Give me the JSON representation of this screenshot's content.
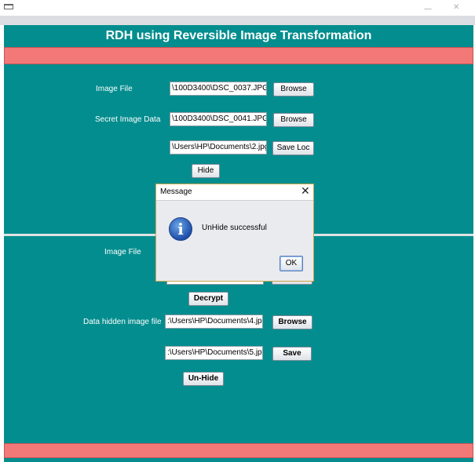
{
  "app": {
    "title": "RDH using Reversible Image Transformation"
  },
  "window": {
    "minimize_glyph": "—",
    "close_glyph": "✕"
  },
  "top_section": {
    "image_file_label": "Image File",
    "image_file_value": "\\100D3400\\DSC_0037.JPG",
    "image_browse_label": "Browse",
    "secret_label": "Secret Image Data",
    "secret_value": "\\100D3400\\DSC_0041.JPG",
    "secret_browse_label": "Browse",
    "save_loc_value": "\\Users\\HP\\Documents\\2.jpg",
    "save_loc_label": "Save Loc",
    "hide_label": "Hide"
  },
  "bottom_section": {
    "image_file_label": "Image File",
    "decrypt_label": "Decrypt",
    "data_hidden_label": "Data hidden image file",
    "data_hidden_value": ":\\Users\\HP\\Documents\\4.jpg",
    "browse_label": "Browse",
    "save_value": ":\\Users\\HP\\Documents\\5.jpg",
    "save_label": "Save",
    "unhide_label": "Un-Hide"
  },
  "dialog": {
    "title": "Message",
    "close_glyph": "✕",
    "icon_glyph": "i",
    "message": "UnHide successful",
    "ok_label": "OK"
  },
  "colors": {
    "panel": "#048d8e",
    "banner": "#f37878",
    "separator": "#e0e2e5"
  }
}
